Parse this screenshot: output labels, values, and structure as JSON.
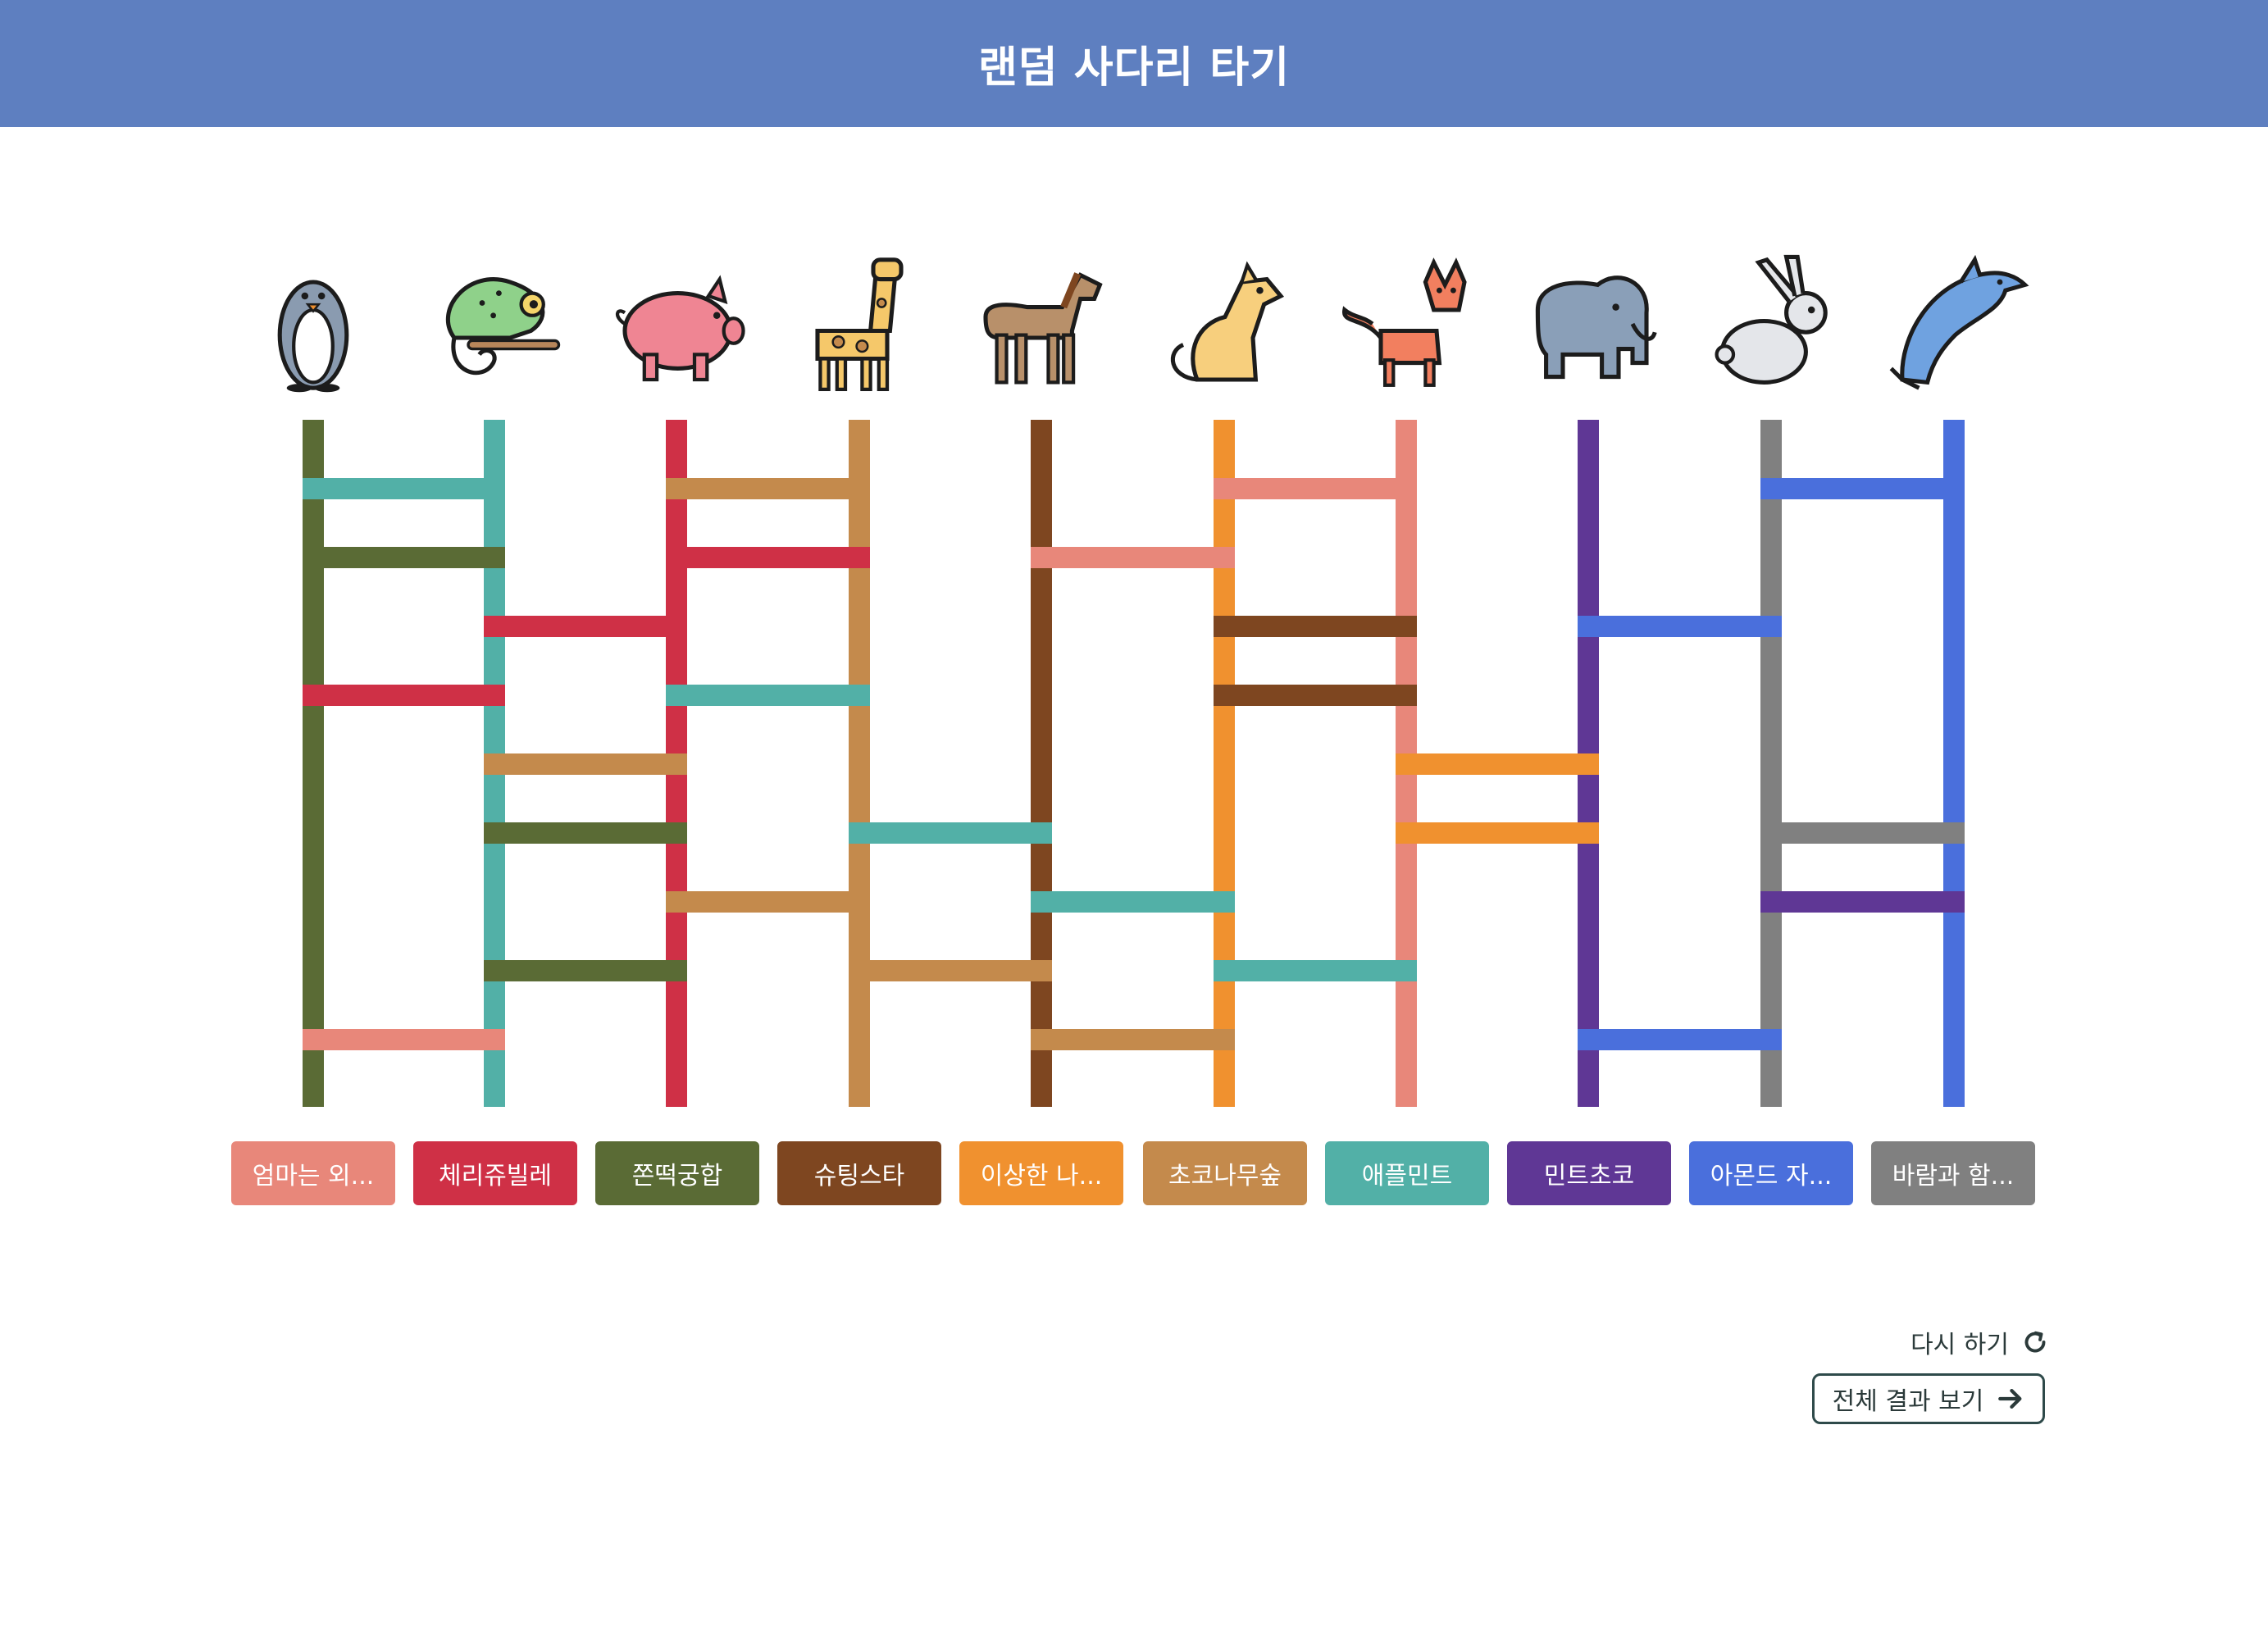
{
  "header": {
    "title": "랜덤 사다리 타기"
  },
  "animals": [
    {
      "icon": "penguin-icon"
    },
    {
      "icon": "chameleon-icon"
    },
    {
      "icon": "pig-icon"
    },
    {
      "icon": "giraffe-icon"
    },
    {
      "icon": "horse-icon"
    },
    {
      "icon": "dog-icon"
    },
    {
      "icon": "fox-icon"
    },
    {
      "icon": "elephant-icon"
    },
    {
      "icon": "rabbit-icon"
    },
    {
      "icon": "dolphin-icon"
    }
  ],
  "results": [
    {
      "label": "엄마는 외...",
      "color": "#e8877a"
    },
    {
      "label": "체리쥬빌레",
      "color": "#cf3046"
    },
    {
      "label": "쫀떡궁합",
      "color": "#5a6b35"
    },
    {
      "label": "슈팅스타",
      "color": "#7e4620"
    },
    {
      "label": "이상한 나...",
      "color": "#f0912f"
    },
    {
      "label": "초코나무숲",
      "color": "#c48a4c"
    },
    {
      "label": "애플민트",
      "color": "#52b0a7"
    },
    {
      "label": "민트초코",
      "color": "#5f3795"
    },
    {
      "label": "아몬드 자...",
      "color": "#4a6fdc"
    },
    {
      "label": "바람과 함...",
      "color": "#808080"
    }
  ],
  "actions": {
    "retry_label": "다시 하기",
    "show_all_label": "전체 결과 보기"
  },
  "colors": {
    "header_bg": "#5e7fc0",
    "rail_colors": [
      "#5a6b35",
      "#52b0a7",
      "#cf3046",
      "#c48a4c",
      "#7e4620",
      "#f0912f",
      "#e8877a",
      "#5f3795",
      "#808080",
      "#4a6fdc"
    ]
  }
}
